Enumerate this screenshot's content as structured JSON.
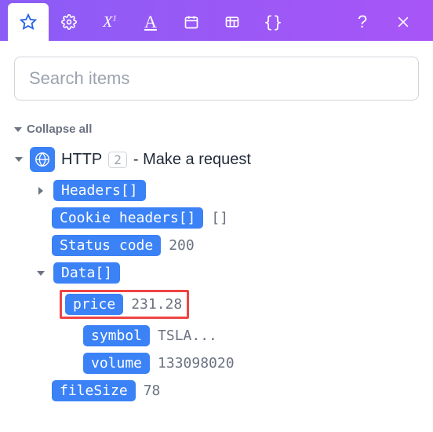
{
  "search": {
    "placeholder": "Search items"
  },
  "collapse_label": "Collapse all",
  "http": {
    "label": "HTTP",
    "count": "2",
    "suffix": "- Make a request"
  },
  "items": {
    "headers": {
      "label": "Headers[]"
    },
    "cookie": {
      "label": "Cookie headers[]",
      "value": "[]"
    },
    "status": {
      "label": "Status code",
      "value": "200"
    },
    "data": {
      "label": "Data[]"
    },
    "price": {
      "label": "price",
      "value": "231.28"
    },
    "symbol": {
      "label": "symbol",
      "value": "TSLA..."
    },
    "volume": {
      "label": "volume",
      "value": "133098020"
    },
    "filesize": {
      "label": "fileSize",
      "value": "78"
    }
  }
}
